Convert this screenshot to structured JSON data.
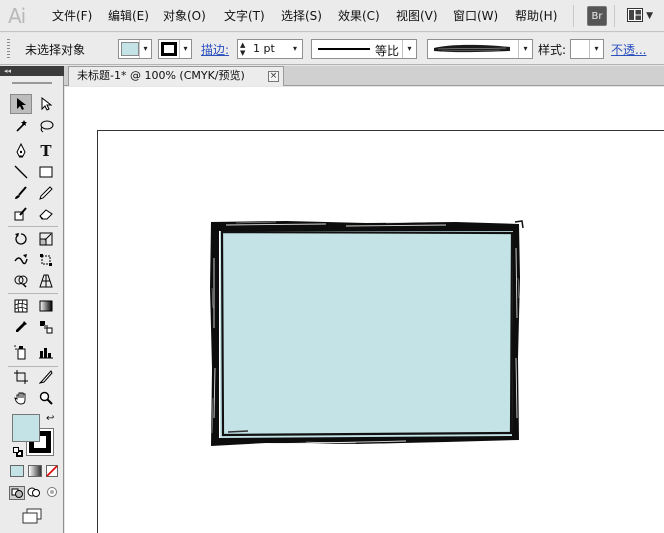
{
  "app": {
    "logo": "Ai"
  },
  "menu": {
    "items": [
      {
        "key": "file",
        "label": "文件(F)"
      },
      {
        "key": "edit",
        "label": "编辑(E)"
      },
      {
        "key": "object",
        "label": "对象(O)"
      },
      {
        "key": "type",
        "label": "文字(T)"
      },
      {
        "key": "select",
        "label": "选择(S)"
      },
      {
        "key": "effect",
        "label": "效果(C)"
      },
      {
        "key": "view",
        "label": "视图(V)"
      },
      {
        "key": "window",
        "label": "窗口(W)"
      },
      {
        "key": "help",
        "label": "帮助(H)"
      }
    ],
    "bridge_label": "Br",
    "workspace_arrow": "▼"
  },
  "control_bar": {
    "selection_status": "未选择对象",
    "fill_color": "#c3e3e7",
    "stroke_label": "描边:",
    "stroke_weight": "1 pt",
    "profile_label": "等比",
    "style_label": "样式:",
    "opacity_label": "不透..."
  },
  "toolbox": {
    "collapse_icon": "◂◂",
    "fill_swatch_color": "#c3e3e7",
    "stroke_swatch_color": "#000000"
  },
  "document": {
    "tab_title": "未标题-1* @ 100% (CMYK/预览)",
    "close_symbol": "×"
  },
  "artwork": {
    "fill_color": "#c3e3e7",
    "stroke_color": "#0d0d0d",
    "stroke_style": "charcoal brush"
  }
}
